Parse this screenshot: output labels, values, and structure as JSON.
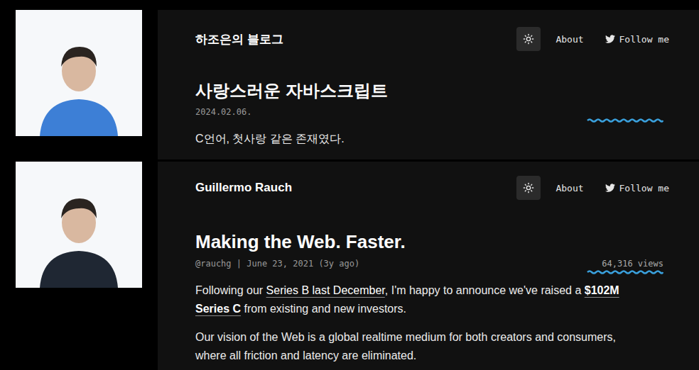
{
  "slides": [
    {
      "blog_title": "하조은의 블로그",
      "nav": {
        "about": "About",
        "follow": "Follow me"
      },
      "post": {
        "title": "사랑스러운 자바스크립트",
        "meta": "2024.02.06.",
        "annotated": true,
        "paragraphs": [
          [
            {
              "text": "C언어, 첫사랑 같은 존재였다.",
              "link": false,
              "bold": false
            }
          ]
        ]
      }
    },
    {
      "blog_title": "Guillermo Rauch",
      "nav": {
        "about": "About",
        "follow": "Follow me"
      },
      "post": {
        "title": "Making the Web. Faster.",
        "meta": "@rauchg | June 23, 2021 (3y ago)",
        "views": "64,316 views",
        "annotated": true,
        "paragraphs": [
          [
            {
              "text": "Following our ",
              "link": false,
              "bold": false
            },
            {
              "text": "Series B last December",
              "link": true,
              "bold": false
            },
            {
              "text": ", I'm happy to announce we've raised a ",
              "link": false,
              "bold": false
            },
            {
              "text": "$102M Series C",
              "link": true,
              "bold": true
            },
            {
              "text": " from existing and new investors.",
              "link": false,
              "bold": false
            }
          ],
          [
            {
              "text": "Our vision of the Web is a global realtime medium for both creators and consumers, where all friction and latency are eliminated.",
              "link": false,
              "bold": false
            }
          ]
        ]
      }
    }
  ]
}
